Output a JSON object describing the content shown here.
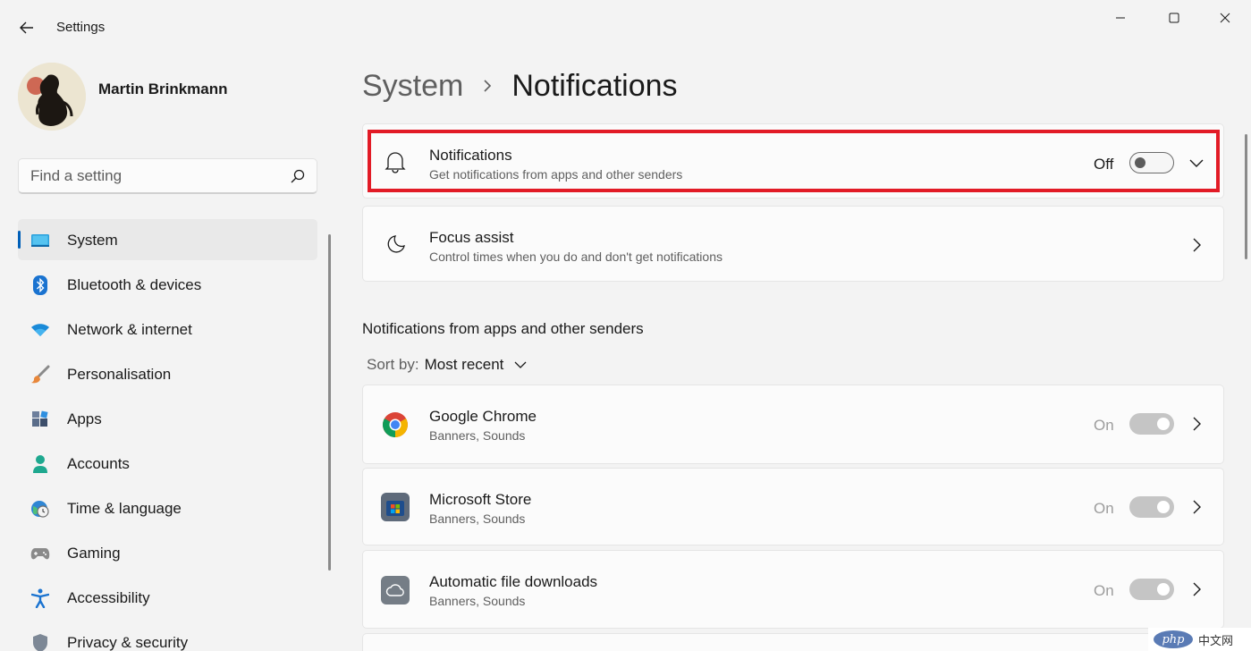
{
  "window": {
    "title": "Settings",
    "controls": [
      "minimize",
      "maximize",
      "close"
    ]
  },
  "profile": {
    "name": "Martin Brinkmann"
  },
  "search": {
    "placeholder": "Find a setting"
  },
  "sidebar": {
    "items": [
      {
        "label": "System",
        "icon": "system-icon",
        "active": true
      },
      {
        "label": "Bluetooth & devices",
        "icon": "bluetooth-icon"
      },
      {
        "label": "Network & internet",
        "icon": "wifi-icon"
      },
      {
        "label": "Personalisation",
        "icon": "brush-icon"
      },
      {
        "label": "Apps",
        "icon": "apps-icon"
      },
      {
        "label": "Accounts",
        "icon": "account-icon"
      },
      {
        "label": "Time & language",
        "icon": "globe-clock-icon"
      },
      {
        "label": "Gaming",
        "icon": "gamepad-icon"
      },
      {
        "label": "Accessibility",
        "icon": "accessibility-icon"
      },
      {
        "label": "Privacy & security",
        "icon": "shield-icon"
      }
    ]
  },
  "breadcrumb": {
    "parent": "System",
    "current": "Notifications"
  },
  "notifications_card": {
    "title": "Notifications",
    "subtitle": "Get notifications from apps and other senders",
    "state_label": "Off",
    "enabled": false
  },
  "focus_card": {
    "title": "Focus assist",
    "subtitle": "Control times when you do and don't get notifications"
  },
  "apps_section": {
    "title": "Notifications from apps and other senders",
    "sort_label": "Sort by:",
    "sort_value": "Most recent",
    "apps": [
      {
        "name": "Google Chrome",
        "detail": "Banners, Sounds",
        "state_label": "On",
        "icon": "chrome-icon"
      },
      {
        "name": "Microsoft Store",
        "detail": "Banners, Sounds",
        "state_label": "On",
        "icon": "store-icon"
      },
      {
        "name": "Automatic file downloads",
        "detail": "Banners, Sounds",
        "state_label": "On",
        "icon": "cloud-icon"
      }
    ]
  },
  "watermark": {
    "logo": "php",
    "text": "中文网"
  },
  "colors": {
    "accent": "#005fb8",
    "highlight_border": "#e21b26",
    "background": "#f3f3f3",
    "card": "#fbfbfb"
  }
}
